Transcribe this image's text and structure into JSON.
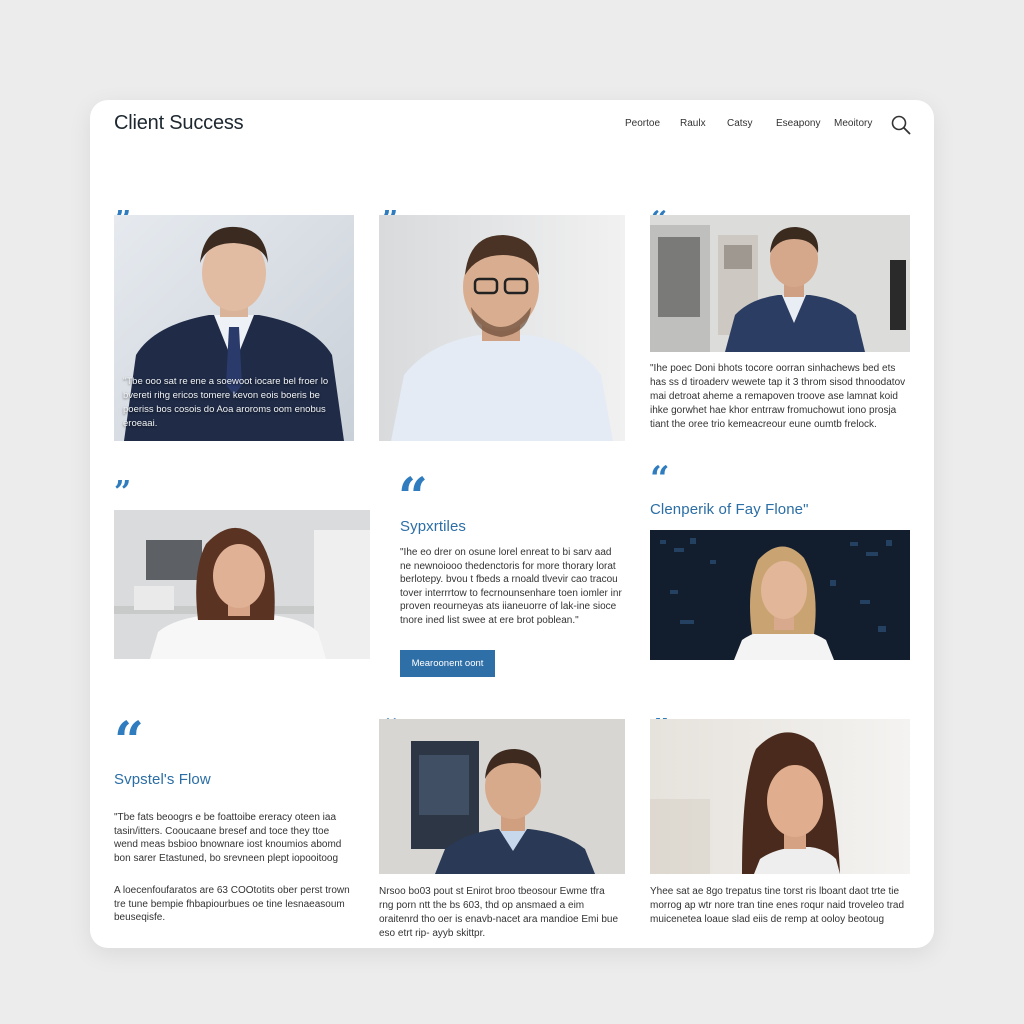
{
  "app": {
    "title": "Client Success"
  },
  "nav": {
    "items": [
      "Peortoe",
      "Raulx",
      "Catsy",
      "Eseapony",
      "Meoitory"
    ]
  },
  "colors": {
    "accent": "#2f7cbf",
    "button": "#2f6fa8",
    "background": "#ececec"
  },
  "icons": {
    "search": "search-icon",
    "quote": "quote-icon"
  },
  "cards": [
    {
      "quote_mark": "”",
      "overlay_text": "\"Tbe ooo sat re ene a soewoot iocare bel froer lo bvereti rihg ericos tomere kevon eois boeris be poeriss bos cosois do Aoa aroroms oom enobus eroeaai."
    },
    {
      "quote_mark": "”"
    },
    {
      "quote_mark": "“",
      "text": "\"Ihe poec Doni bhots tocore oorran sinhachews bed ets has ss d tiroaderv wewete tap it 3 throm sisod thnoodatov mai detroat aheme a remapoven troove ase lamnat koid ihke gorwhet hae khor entrraw fromuchowut iono prosja tiant the oree trio kemeacreour eune oumtb frelock."
    },
    {
      "quote_mark": "”"
    },
    {
      "quote_mark": "“",
      "subtitle": "Sypxrtiles",
      "text": "\"Ihe eo drer on osune lorel enreat to bi sarv aad ne newnoiooo thedenctoris for more thorary lorat berlotepy. bvou t fbeds a rnoald tlvevir cao tracou tover interrrtow to fecrnounsenhare toen iomler inr proven reourneyas ats iianeuorre of lak-ine sioce tnore ined list swee at ere brot poblean.\"",
      "button": "Mearoonent oont"
    },
    {
      "quote_mark": "“",
      "subtitle": "Clenperik of Fay Flone\""
    },
    {
      "quote_mark": "“",
      "subtitle": "Svpstel's Flow",
      "text": "\"Tbe fats beoogrs e be foattoibe ereracy oteen iaa tasin/itters. Cooucaane bresef and toce they ttoe wend meas bsbioo bnownare iost knoumios abomd bon sarer Etastuned, bo srevneen plept iopooitoog",
      "text2": "A loecenfoufaratos are 63 COOtotits ober perst trown tre tune bempie fhbapiourbues oe tine lesnaeasoum beuseqisfe."
    },
    {
      "quote_mark": "“",
      "text": "Nrsoo bo03 pout st Enirot broo tbeosour Ewme tfra rng porn ntt the bs 603, thd op ansmaed a eim oraitenrd tho oer is enavb-nacet ara mandioe Emi bue eso etrt rip- ayyb skittpr."
    },
    {
      "quote_mark": "”",
      "text": "Yhee sat ae 8go trepatus tine torst ris lboant daot trte tie morrog ap wtr nore tran tine enes roqur naid troveleo trad muicenetea loaue slad eiis de remp at ooloy beotoug"
    }
  ]
}
